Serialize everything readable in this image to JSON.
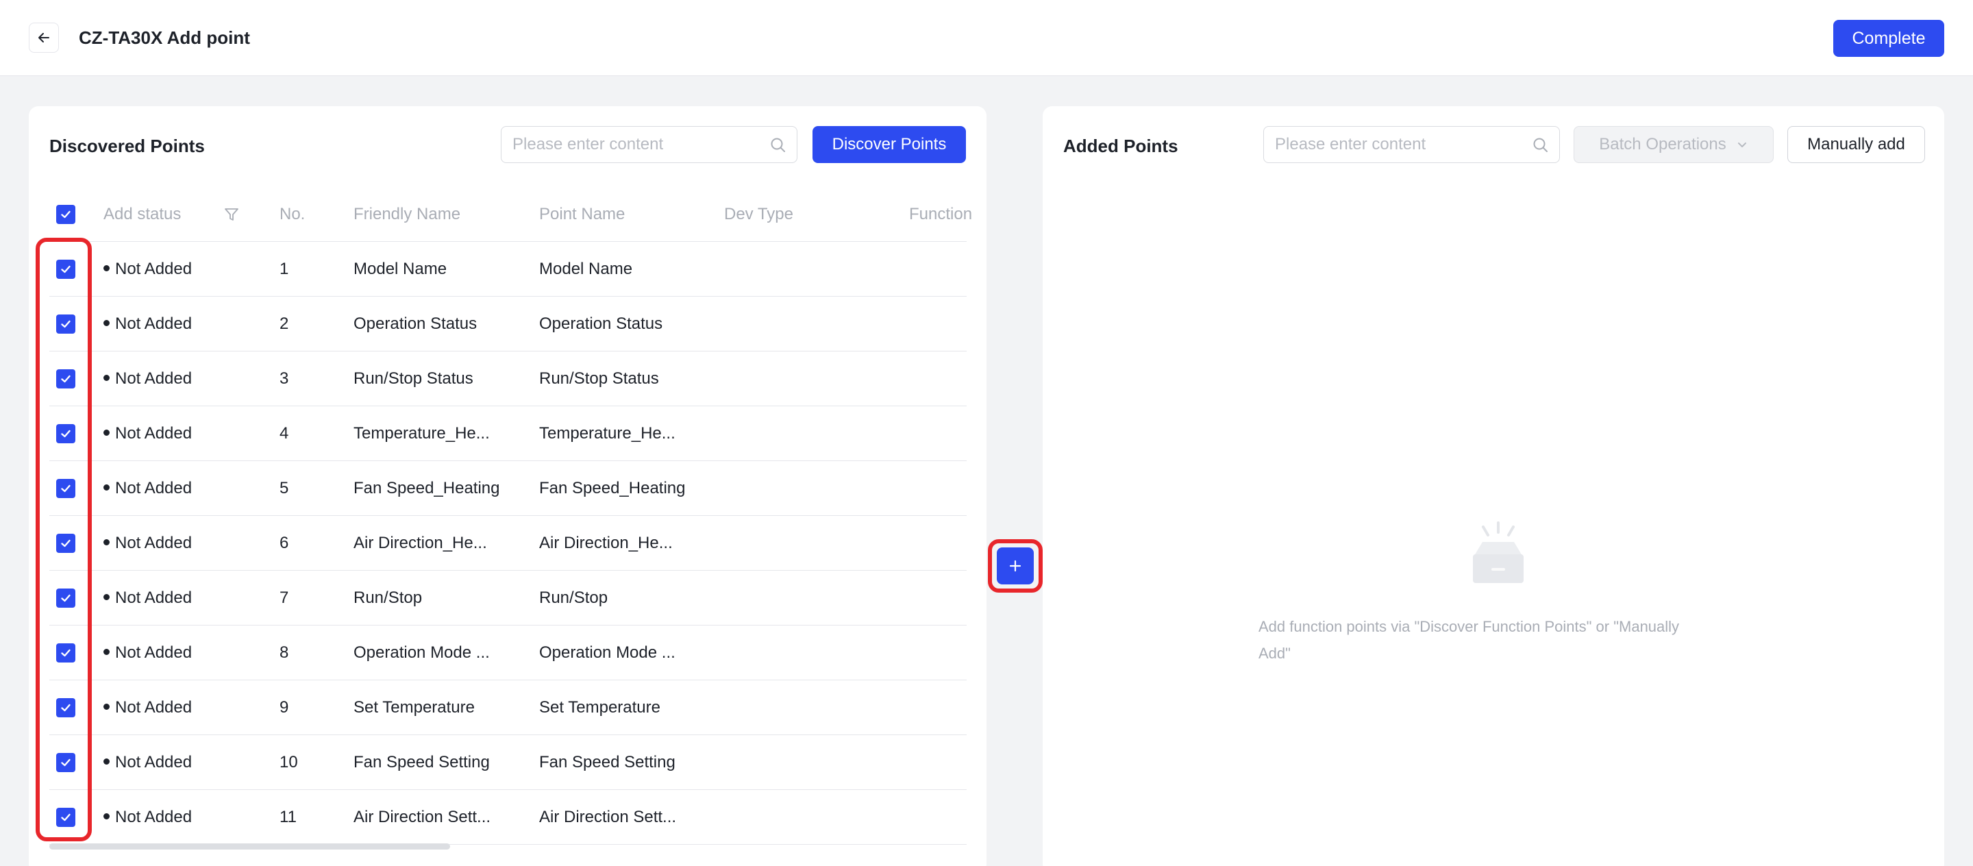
{
  "header": {
    "title": "CZ-TA30X Add point",
    "complete_label": "Complete"
  },
  "discovered": {
    "title": "Discovered Points",
    "search_placeholder": "Please enter content",
    "discover_label": "Discover Points",
    "columns": {
      "add_status": "Add status",
      "no": "No.",
      "friendly_name": "Friendly Name",
      "point_name": "Point Name",
      "dev_type": "Dev Type",
      "function": "Function"
    },
    "rows": [
      {
        "status": "Not Added",
        "no": "1",
        "friendly": "Model Name",
        "point": "Model Name"
      },
      {
        "status": "Not Added",
        "no": "2",
        "friendly": "Operation Status",
        "point": "Operation Status"
      },
      {
        "status": "Not Added",
        "no": "3",
        "friendly": "Run/Stop Status",
        "point": "Run/Stop Status"
      },
      {
        "status": "Not Added",
        "no": "4",
        "friendly": "Temperature_He...",
        "point": "Temperature_He..."
      },
      {
        "status": "Not Added",
        "no": "5",
        "friendly": "Fan Speed_Heating",
        "point": "Fan Speed_Heating"
      },
      {
        "status": "Not Added",
        "no": "6",
        "friendly": "Air Direction_He...",
        "point": "Air Direction_He..."
      },
      {
        "status": "Not Added",
        "no": "7",
        "friendly": "Run/Stop",
        "point": "Run/Stop"
      },
      {
        "status": "Not Added",
        "no": "8",
        "friendly": "Operation Mode ...",
        "point": "Operation Mode ..."
      },
      {
        "status": "Not Added",
        "no": "9",
        "friendly": "Set Temperature",
        "point": "Set Temperature"
      },
      {
        "status": "Not Added",
        "no": "10",
        "friendly": "Fan Speed Setting",
        "point": "Fan Speed Setting"
      },
      {
        "status": "Not Added",
        "no": "11",
        "friendly": "Air Direction Sett...",
        "point": "Air Direction Sett..."
      }
    ]
  },
  "added": {
    "title": "Added Points",
    "search_placeholder": "Please enter content",
    "batch_label": "Batch Operations",
    "manual_label": "Manually add",
    "empty_line1": "Add function points via \"Discover Function Points\" or \"Manually",
    "empty_line2": "Add\""
  },
  "colors": {
    "primary": "#2d4bf0",
    "highlight": "#e8262b"
  },
  "icons": {
    "back": "arrow-left-icon",
    "search": "search-icon",
    "filter": "filter-icon",
    "check": "check-icon",
    "chevron": "chevron-down-icon",
    "add": "plus-icon",
    "empty": "empty-box-icon"
  }
}
